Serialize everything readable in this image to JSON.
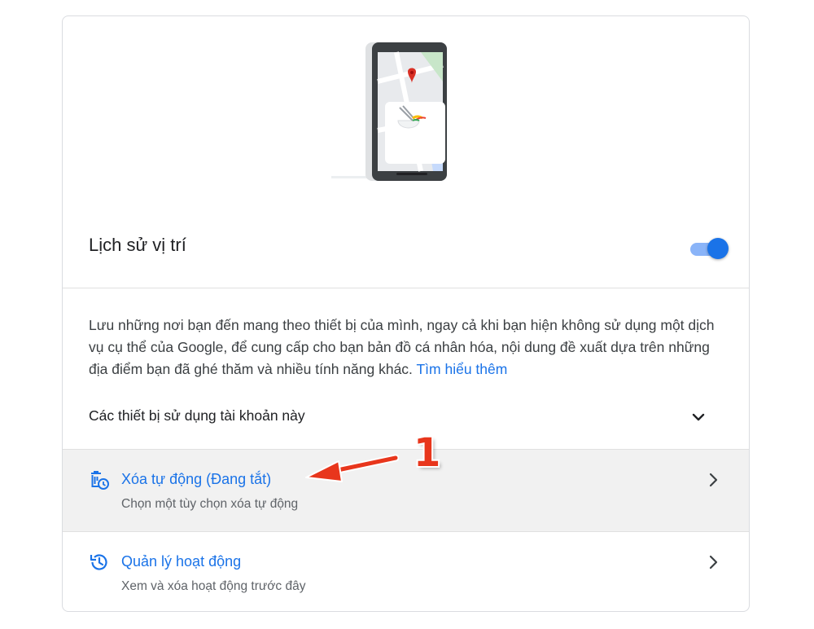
{
  "location_history": {
    "title": "Lịch sử vị trí",
    "toggle_state": "on",
    "description": "Lưu những nơi bạn đến mang theo thiết bị của mình, ngay cả khi bạn hiện không sử dụng một dịch vụ cụ thể của Google, để cung cấp cho bạn bản đồ cá nhân hóa, nội dung đề xuất dựa trên những địa điểm bạn đã ghé thăm và nhiều tính năng khác.",
    "learn_more": "Tìm hiểu thêm",
    "devices_label": "Các thiết bị sử dụng tài khoản này"
  },
  "options": [
    {
      "title": "Xóa tự động (Đang tắt)",
      "subtitle": "Chọn một tùy chọn xóa tự động",
      "icon": "auto-delete-icon"
    },
    {
      "title": "Quản lý hoạt động",
      "subtitle": "Xem và xóa hoạt động trước đây",
      "icon": "history-icon"
    }
  ],
  "annotation": {
    "number": "1",
    "color": "#e8361c"
  },
  "colors": {
    "accent": "#1a73e8",
    "toggle_track": "#8ab4f8",
    "highlight": "#f1f1f1"
  }
}
